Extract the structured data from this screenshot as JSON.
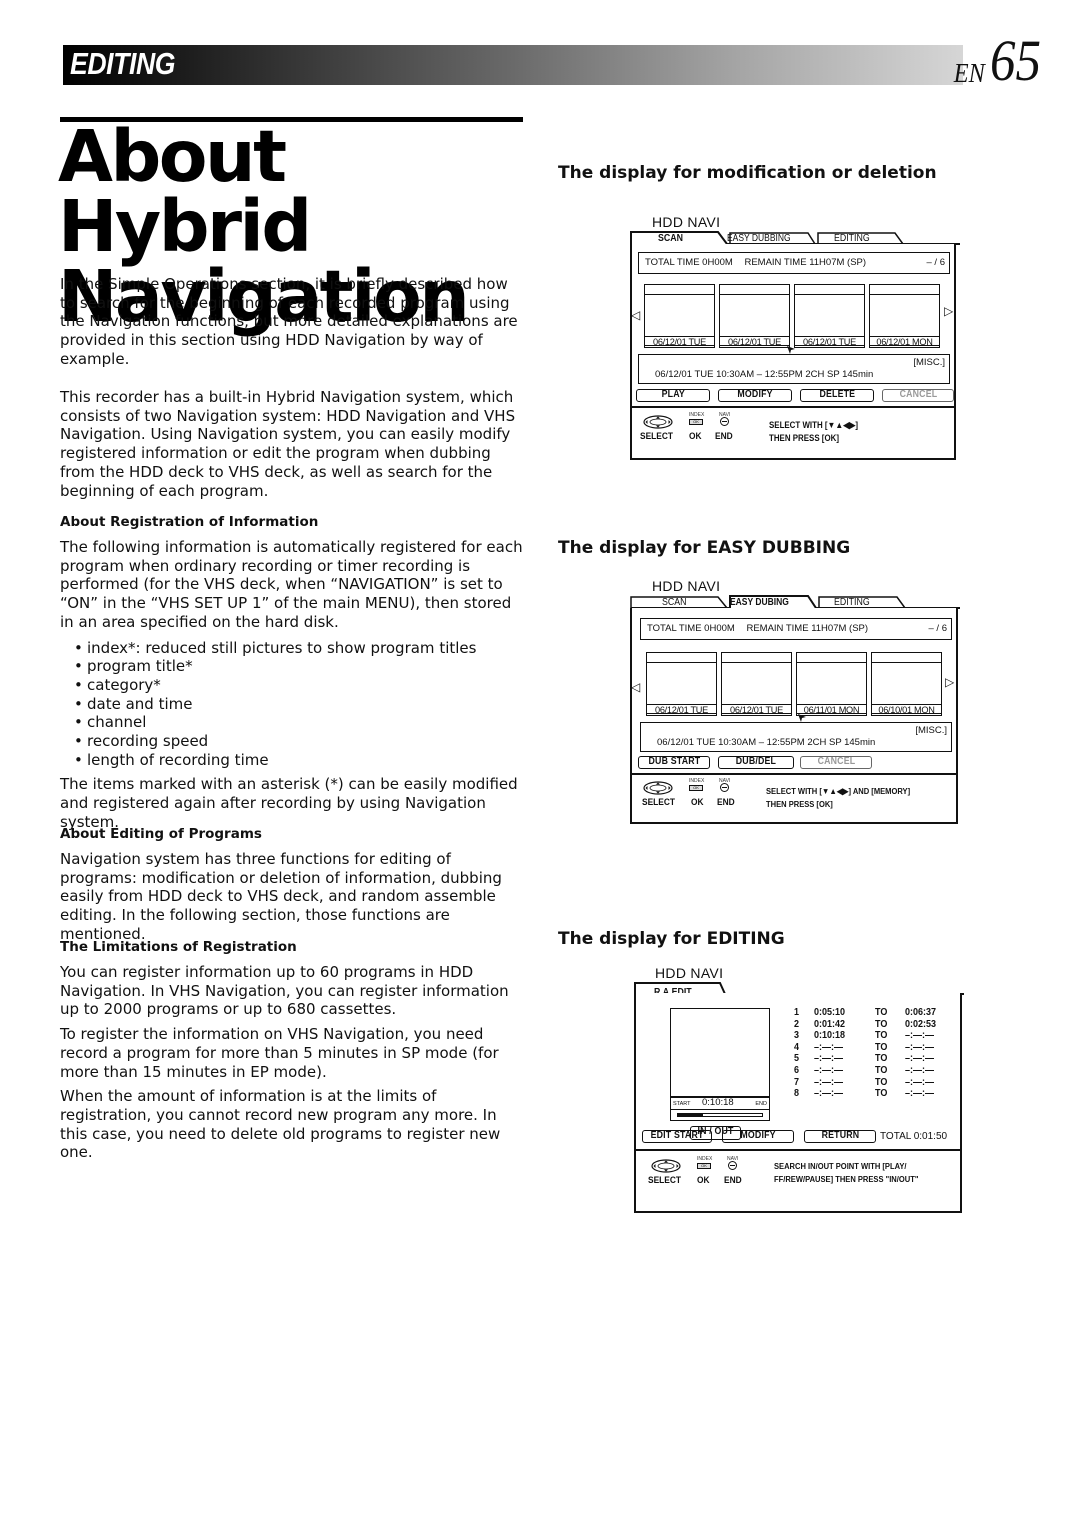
{
  "header": {
    "section": "EDITING",
    "lang": "EN",
    "page_number": "65"
  },
  "title": {
    "line1": "About Hybrid",
    "line2": "Navigation"
  },
  "left": {
    "intro": "In the Simple Operations section, it is briefly described how to search for the beginning of each recorded program using the Navigation functions, but more detailed explanations are provided in this section using HDD Navigation by way of example.",
    "system": "This recorder has a built-in Hybrid Navigation system, which consists of two Navigation system: HDD Navigation and VHS Navigation. Using Navigation system, you can easily modify registered information or edit the program when dubbing from the HDD deck to VHS deck, as well as search for the beginning of each program.",
    "registration": {
      "heading": "About Registration of Information",
      "body": "The following information is automatically registered for each program when ordinary recording or timer recording is performed (for the VHS deck, when “NAVIGATION” is set to “ON” in the “VHS SET UP 1” of the main MENU), then stored in an area specified on the hard disk.",
      "items": [
        "index*: reduced still pictures to show program titles",
        "program title*",
        "category*",
        "date and time",
        "channel",
        "recording speed",
        "length of recording time"
      ],
      "note": "The items marked with an asterisk (*) can be easily modified and registered again after recording by using Navigation system."
    },
    "editing": {
      "heading": "About Editing of Programs",
      "body": "Navigation system has three functions for editing of programs: modification or deletion of information, dubbing easily from HDD deck to VHS deck, and random assemble editing. In the following section, those functions are mentioned."
    },
    "limitations": {
      "heading": "The Limitations of Registration",
      "p1": "You can register information up to 60 programs in HDD Navigation. In VHS Navigation, you can register information up to 2000 programs or up to 680 cassettes.",
      "p2": "To register the information on VHS Navigation, you need record a program for more than 5 minutes in SP mode (for more than 15 minutes in EP mode).",
      "p3": "When the amount of information is at the limits of registration, you cannot record new program any more. In this case, you need to delete old programs to register new one."
    }
  },
  "panels": {
    "modify": {
      "heading": "The display for modification or deletion",
      "label": "HDD NAVI",
      "tabs": [
        "SCAN",
        "EASY DUBBING",
        "EDITING"
      ],
      "active_tab": 0,
      "total_time": "TOTAL TIME  0H00M",
      "remain_time": "REMAIN TIME 11H07M (SP)",
      "page": "– / 6",
      "thumbs": [
        "06/12/01 TUE",
        "06/12/01 TUE",
        "06/12/01 TUE",
        "06/12/01 MON"
      ],
      "category": "[MISC.]",
      "record_info": "06/12/01 TUE 10:30AM – 12:55PM   2CH   SP  145min",
      "buttons": [
        {
          "label": "PLAY",
          "enabled": true
        },
        {
          "label": "MODIFY",
          "enabled": true
        },
        {
          "label": "DELETE",
          "enabled": true
        },
        {
          "label": "CANCEL",
          "enabled": false
        }
      ],
      "legend": {
        "index": "INDEX",
        "navi": "NAVI",
        "ok_key": "OK",
        "select": "SELECT",
        "ok": "OK",
        "end": "END"
      },
      "instructions": [
        "SELECT WITH  [▼▲◀▶]",
        "THEN PRESS    [OK]"
      ]
    },
    "dubbing": {
      "heading": "The display for EASY DUBBING",
      "label": "HDD NAVI",
      "tabs": [
        "SCAN",
        "EASY DUBING",
        "EDITING"
      ],
      "active_tab": 1,
      "total_time": "TOTAL TIME  0H00M",
      "remain_time": "REMAIN TIME 11H07M (SP)",
      "page": "– / 6",
      "thumbs": [
        "06/12/01 TUE",
        "06/12/01 TUE",
        "06/11/01 MON",
        "06/10/01 MON"
      ],
      "category": "[MISC.]",
      "record_info": "06/12/01 TUE 10:30AM – 12:55PM   2CH   SP  145min",
      "buttons": [
        {
          "label": "DUB START",
          "enabled": true
        },
        {
          "label": "DUB/DEL",
          "enabled": true
        },
        {
          "label": "CANCEL",
          "enabled": false
        }
      ],
      "legend": {
        "index": "INDEX",
        "navi": "NAVI",
        "ok_key": "OK",
        "select": "SELECT",
        "ok": "OK",
        "end": "END"
      },
      "instructions": [
        "SELECT WITH  [▼▲◀▶] AND [MEMORY]",
        "THEN PRESS    [OK]"
      ]
    },
    "editing": {
      "heading": "The display for EDITING",
      "label": "HDD NAVI",
      "tab": "R.A.EDIT",
      "timebar": {
        "start": "START",
        "time": "0:10:18",
        "end": "END",
        "progress": 0.3
      },
      "in_out": "IN / OUT",
      "to_label": "TO",
      "rows": [
        {
          "n": "1",
          "in": "0:05:10",
          "out": "0:06:37"
        },
        {
          "n": "2",
          "in": "0:01:42",
          "out": "0:02:53"
        },
        {
          "n": "3",
          "in": "0:10:18",
          "out": "–:—:—"
        },
        {
          "n": "4",
          "in": "–:—:—",
          "out": "–:—:—"
        },
        {
          "n": "5",
          "in": "–:—:—",
          "out": "–:—:—"
        },
        {
          "n": "6",
          "in": "–:—:—",
          "out": "–:—:—"
        },
        {
          "n": "7",
          "in": "–:—:—",
          "out": "–:—:—"
        },
        {
          "n": "8",
          "in": "–:—:—",
          "out": "–:—:—"
        }
      ],
      "buttons": [
        {
          "label": "EDIT START",
          "enabled": true
        },
        {
          "label": "MODIFY",
          "enabled": true
        },
        {
          "label": "RETURN",
          "enabled": true
        }
      ],
      "total": "TOTAL 0:01:50",
      "legend": {
        "index": "INDEX",
        "navi": "NAVI",
        "ok_key": "OK",
        "select": "SELECT",
        "ok": "OK",
        "end": "END"
      },
      "instructions": [
        "SEARCH IN/OUT POINT WITH [PLAY/",
        "FF/REW/PAUSE] THEN PRESS \"IN/OUT\""
      ]
    }
  }
}
